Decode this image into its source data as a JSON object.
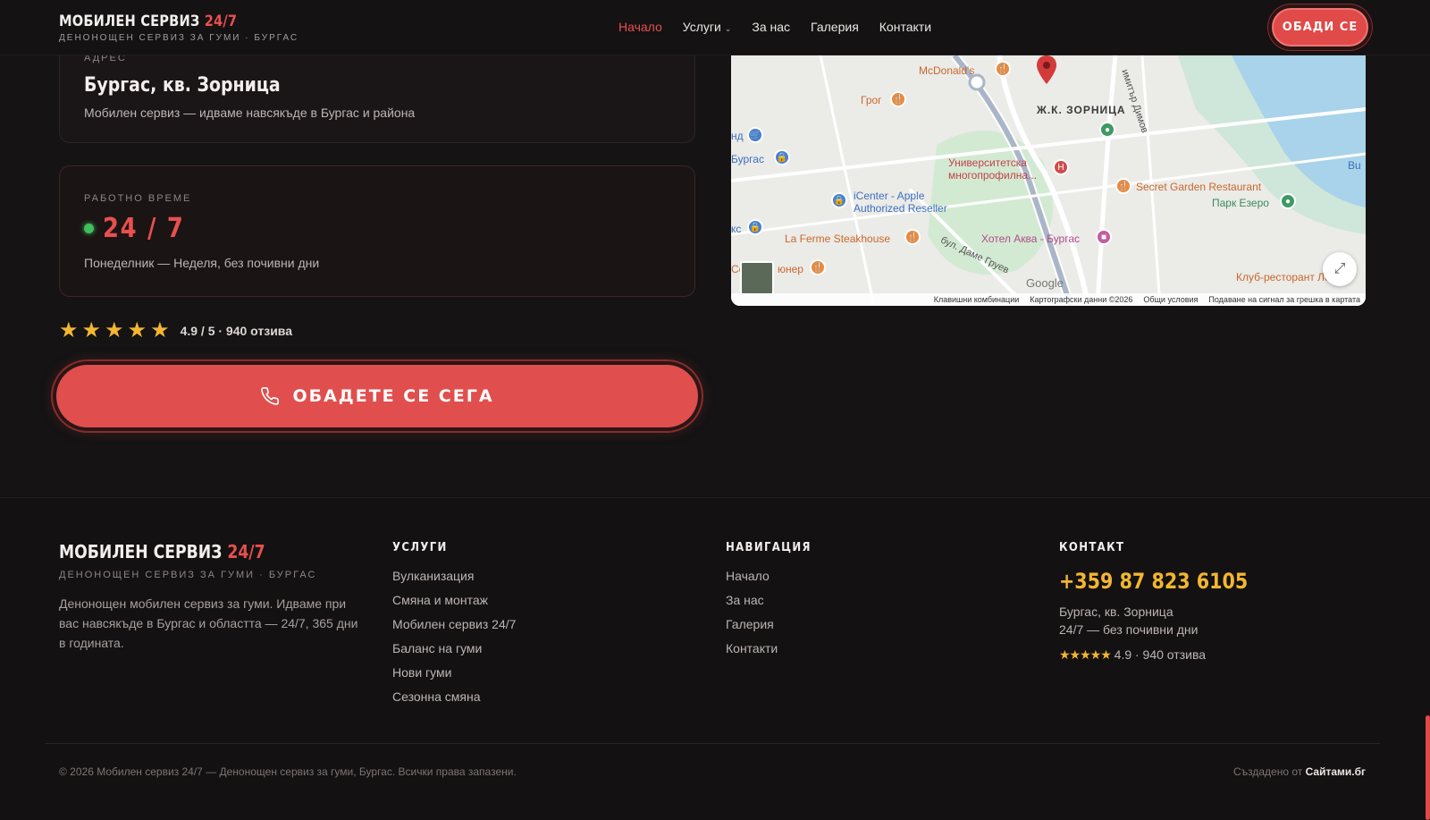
{
  "header": {
    "brand_main": "МОБИЛЕН СЕРВИЗ",
    "brand_accent": "24/7",
    "brand_sub": "ДЕНОНОЩЕН СЕРВИЗ ЗА ГУМИ · БУРГАС",
    "nav": [
      {
        "label": "Начало",
        "active": true
      },
      {
        "label": "Услуги",
        "has_dropdown": true
      },
      {
        "label": "За нас"
      },
      {
        "label": "Галерия"
      },
      {
        "label": "Контакти"
      }
    ],
    "call_button": "ОБАДИ СЕ"
  },
  "address_card": {
    "label": "АДРЕС",
    "title": "Бургас, кв. Зорница",
    "description": "Мобилен сервиз — идваме навсякъде в Бургас и района"
  },
  "hours_card": {
    "label": "РАБОТНО ВРЕМЕ",
    "value": "24 / 7",
    "description": "Понеделник — Неделя, без почивни дни"
  },
  "rating": {
    "stars": 5,
    "text": "4.9 / 5 · 940 отзива"
  },
  "cta": {
    "label": "ОБАДЕТЕ СЕ СЕГА"
  },
  "map": {
    "labels": {
      "mcdonalds": "McDonald's",
      "grog": "Грог",
      "zornitsa": "Ж.К. ЗОРНИЦА",
      "street_dimov": "имитър Димов",
      "burgas": "Бургас",
      "nd": "нд",
      "university": "Университетска\nмногопрофилна...",
      "secret_garden": "Secret Garden Restaurant",
      "park_ezero": "Парк Езеро",
      "bu": "Bu",
      "icenter": "iCenter - Apple\nAuthorized Reseller",
      "la_ferme": "La Ferme Steakhouse",
      "hotel_akva": "Хотел Аква - Бургас",
      "dame_gruev": "бул. Даме Груев",
      "yuner": "юнер",
      "klub": "Клуб-ресторант Ле Vie",
      "ks": "кс",
      "se": "Се"
    },
    "google": "Google",
    "footer_links": [
      "Клавишни комбинации",
      "Картографски данни ©2026",
      "Общи условия",
      "Подаване на сигнал за грешка в картата"
    ]
  },
  "footer": {
    "brand_main": "МОБИЛЕН СЕРВИЗ",
    "brand_accent": "24/7",
    "brand_sub": "ДЕНОНОЩЕН СЕРВИЗ ЗА ГУМИ · БУРГАС",
    "description": "Денонощен мобилен сервиз за гуми. Идваме при вас навсякъде в Бургас и областта — 24/7, 365 дни в годината.",
    "services": {
      "title": "УСЛУГИ",
      "items": [
        "Вулканизация",
        "Смяна и монтаж",
        "Мобилен сервиз 24/7",
        "Баланс на гуми",
        "Нови гуми",
        "Сезонна смяна"
      ]
    },
    "navigation": {
      "title": "НАВИГАЦИЯ",
      "items": [
        "Начало",
        "За нас",
        "Галерия",
        "Контакти"
      ]
    },
    "contact": {
      "title": "КОНТАКТ",
      "phone": "+359 87 823 6105",
      "address": "Бургас, кв. Зорница",
      "hours": "24/7 — без почивни дни",
      "rating_stars": "★★★★★",
      "rating_text": "4.9 · 940 отзива"
    },
    "copyright": "© 2026 Мобилен сервиз 24/7 — Денонощен сервиз за гуми, Бургас. Всички права запазени.",
    "credit_prefix": "Създадено от",
    "credit_name": "Сайтами.бг"
  },
  "colors": {
    "accent": "#e04a48",
    "gold": "#f2b630",
    "background": "#151314",
    "status_green": "#3fbf5b"
  }
}
